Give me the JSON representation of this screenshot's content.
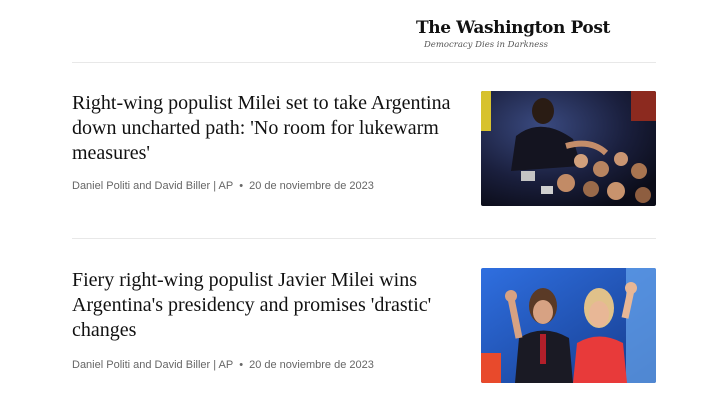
{
  "masthead": {
    "logo_text": "The Washington Post",
    "tagline": "Democracy Dies in Darkness"
  },
  "articles": [
    {
      "headline": "Right-wing populist Milei set to take Argentina down uncharted path: 'No room for lukewarm measures'",
      "authors": "Daniel Politi and David Biller | AP",
      "separator": "•",
      "date": "20 de noviembre de 2023"
    },
    {
      "headline": "Fiery right-wing populist Javier Milei wins Argentina's presidency and promises 'drastic' changes",
      "authors": "Daniel Politi and David Biller | AP",
      "separator": "•",
      "date": "20 de noviembre de 2023"
    }
  ]
}
